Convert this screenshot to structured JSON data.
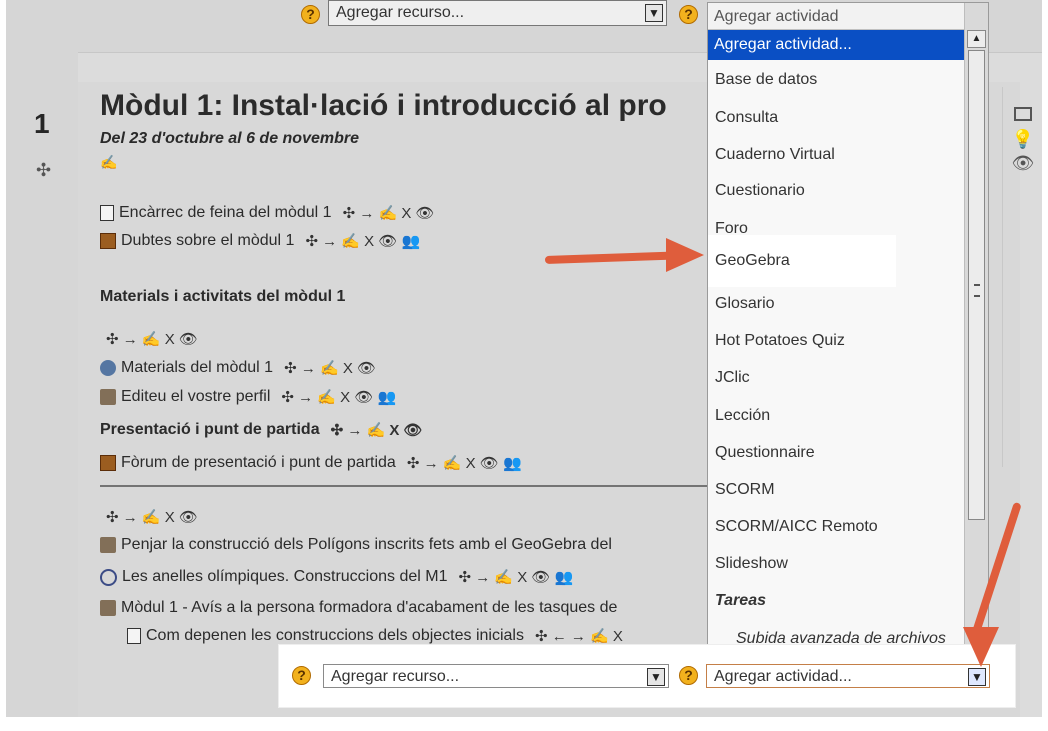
{
  "top_controls": {
    "resource_placeholder": "Agregar recurso...",
    "activity_placeholder": "Agregar actividad",
    "help_symbol": "?"
  },
  "section": {
    "number": "1",
    "title": "Mòdul 1: Instal·lació i introducció al pro",
    "dates": "Del 23 d'octubre al 6 de novembre",
    "edit_symbol": "✍"
  },
  "items": [
    {
      "label": "Encàrrec de feina del mòdul 1",
      "icon": "document-icon",
      "actions": "✣ → ✍ X 👁"
    },
    {
      "label": "Dubtes sobre el mòdul 1",
      "icon": "forum-icon",
      "actions": "✣ → ✍ X 👁 👥"
    },
    {
      "label": "Materials i activitats del mòdul 1",
      "icon": "",
      "actions": ""
    },
    {
      "label": "",
      "icon": "",
      "actions": "✣ → ✍ X 👁"
    },
    {
      "label": "Materials del mòdul 1",
      "icon": "resource-icon",
      "actions": "✣ → ✍ X 👁"
    },
    {
      "label": "Editeu el vostre perfil",
      "icon": "assignment-icon",
      "actions": "✣ → ✍ X 👁 👥"
    },
    {
      "label": "Presentació i punt de partida",
      "icon": "",
      "actions": "✣ → ✍ X 👁"
    },
    {
      "label": "Fòrum de presentació i punt de partida",
      "icon": "forum-icon",
      "actions": "✣ → ✍ X 👁 👥"
    },
    {
      "label": "",
      "icon": "",
      "actions": "✣ → ✍ X 👁"
    },
    {
      "label": "Penjar la construcció dels Polígons inscrits fets amb el GeoGebra del",
      "icon": "assignment-icon",
      "actions": ""
    },
    {
      "label": "Les anelles olímpiques. Construccions del M1",
      "icon": "olympic-ring-icon",
      "actions": "✣ → ✍ X 👁 👥"
    },
    {
      "label": "Mòdul 1 - Avís a la persona formadora d'acabament de les tasques de",
      "icon": "assignment-icon",
      "actions": ""
    },
    {
      "label": "Com depenen les construccions dels objectes inicials",
      "icon": "document-icon",
      "actions": "✣ ← → ✍ X"
    }
  ],
  "dropdown": {
    "selected": "Agregar actividad...",
    "options": [
      "Base de datos",
      "Consulta",
      "Cuaderno Virtual",
      "Cuestionario",
      "Foro",
      "GeoGebra",
      "Glosario",
      "Hot Potatoes Quiz",
      "JClic",
      "Lección",
      "Questionnaire",
      "SCORM",
      "SCORM/AICC Remoto",
      "Slideshow",
      "Tareas",
      "Subida avanzada de archivos"
    ]
  },
  "bottom_controls": {
    "resource_placeholder": "Agregar recurso...",
    "activity_placeholder": "Agregar actividad...",
    "help_symbol": "?"
  },
  "colors": {
    "selection_blue": "#0a4fc4",
    "arrow_red": "#df5d3c",
    "help_gold": "#f2b11d"
  }
}
